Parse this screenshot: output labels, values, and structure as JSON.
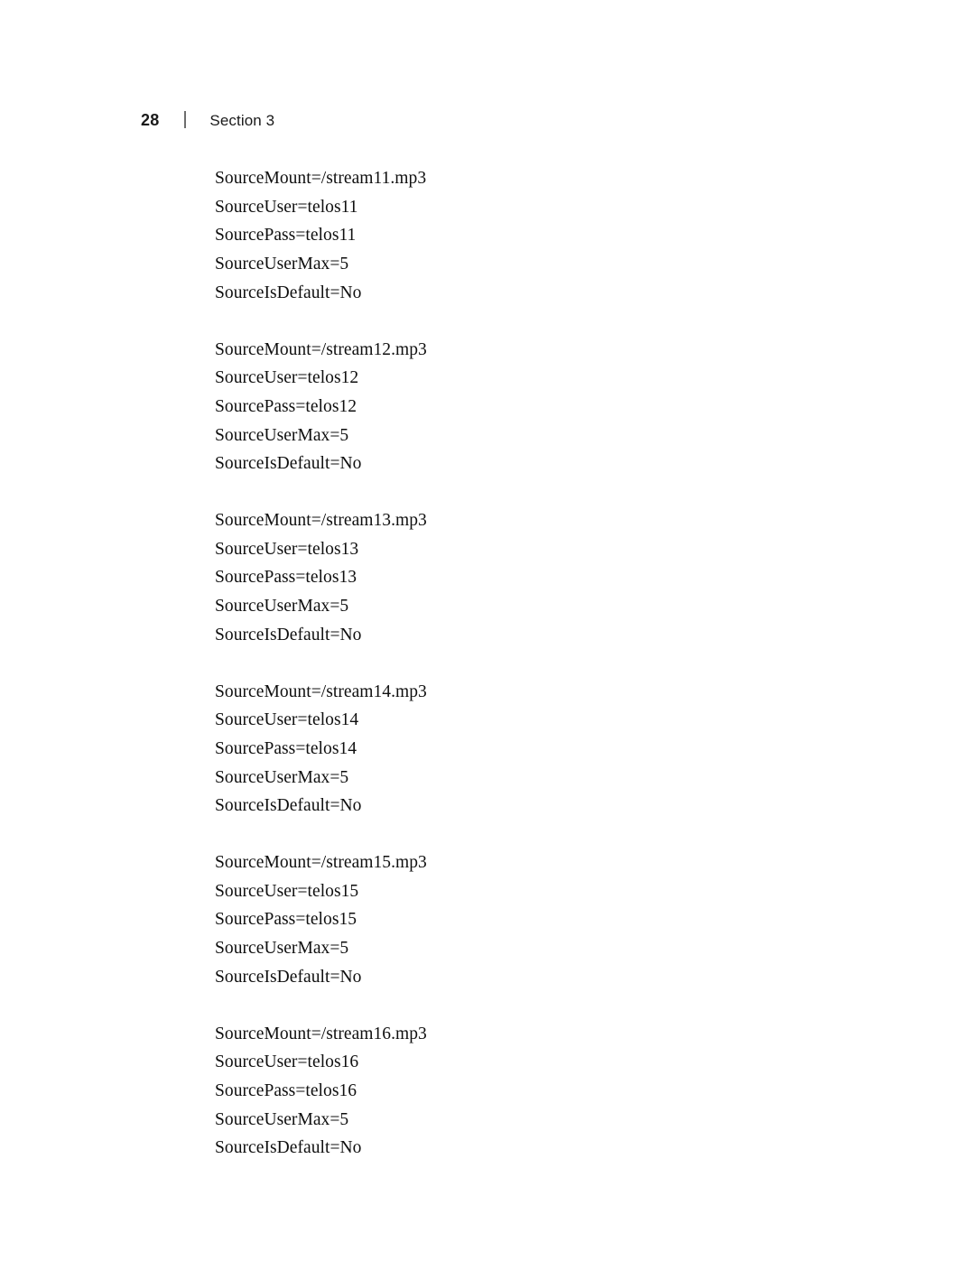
{
  "header": {
    "folio": "28",
    "divider": "|",
    "section_label": "Section 3"
  },
  "body": {
    "blocks": [
      {
        "lines": [
          "SourceMount=/stream11.mp3",
          "SourceUser=telos11",
          "SourcePass=telos11",
          "SourceUserMax=5",
          "SourceIsDefault=No"
        ]
      },
      {
        "lines": [
          "SourceMount=/stream12.mp3",
          "SourceUser=telos12",
          "SourcePass=telos12",
          "SourceUserMax=5",
          "SourceIsDefault=No"
        ]
      },
      {
        "lines": [
          "SourceMount=/stream13.mp3",
          "SourceUser=telos13",
          "SourcePass=telos13",
          "SourceUserMax=5",
          "SourceIsDefault=No"
        ]
      },
      {
        "lines": [
          "SourceMount=/stream14.mp3",
          "SourceUser=telos14",
          "SourcePass=telos14",
          "SourceUserMax=5",
          "SourceIsDefault=No"
        ]
      },
      {
        "lines": [
          "SourceMount=/stream15.mp3",
          "SourceUser=telos15",
          "SourcePass=telos15",
          "SourceUserMax=5",
          "SourceIsDefault=No"
        ]
      },
      {
        "lines": [
          "SourceMount=/stream16.mp3",
          "SourceUser=telos16",
          "SourcePass=telos16",
          "SourceUserMax=5",
          "SourceIsDefault=No"
        ]
      }
    ]
  },
  "colors": {
    "page_background": "#ffffff",
    "body_text": "#0f0f0f",
    "header_text": "#1a1a1a",
    "header_divider": "#6e6e6e"
  }
}
